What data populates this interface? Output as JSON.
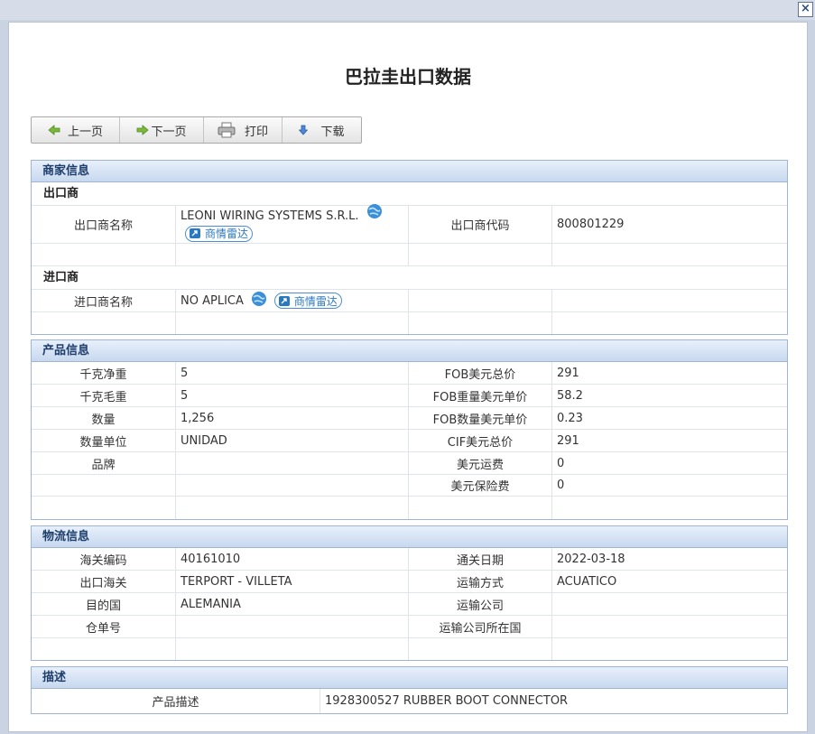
{
  "page_title": "巴拉圭出口数据",
  "toolbar": {
    "prev": "上一页",
    "next": "下一页",
    "print": "打印",
    "download": "下载"
  },
  "merchant": {
    "header": "商家信息",
    "exporter_heading": "出口商",
    "exporter_name_label": "出口商名称",
    "exporter_name": "LEONI WIRING SYSTEMS S.R.L.",
    "exporter_code_label": "出口商代码",
    "exporter_code": "800801229",
    "importer_heading": "进口商",
    "importer_name_label": "进口商名称",
    "importer_name": "NO APLICA",
    "radar_label": "商情雷达"
  },
  "product": {
    "header": "产品信息",
    "rows": [
      {
        "l1": "千克净重",
        "v1": "5",
        "l2": "FOB美元总价",
        "v2": "291"
      },
      {
        "l1": "千克毛重",
        "v1": "5",
        "l2": "FOB重量美元单价",
        "v2": "58.2"
      },
      {
        "l1": "数量",
        "v1": "1,256",
        "l2": "FOB数量美元单价",
        "v2": "0.23"
      },
      {
        "l1": "数量单位",
        "v1": "UNIDAD",
        "l2": "CIF美元总价",
        "v2": "291"
      },
      {
        "l1": "品牌",
        "v1": "",
        "l2": "美元运费",
        "v2": "0"
      },
      {
        "l1": "",
        "v1": "",
        "l2": "美元保险费",
        "v2": "0"
      }
    ]
  },
  "logistics": {
    "header": "物流信息",
    "rows": [
      {
        "l1": "海关编码",
        "v1": "40161010",
        "l2": "通关日期",
        "v2": "2022-03-18"
      },
      {
        "l1": "出口海关",
        "v1": "TERPORT - VILLETA",
        "l2": "运输方式",
        "v2": "ACUATICO"
      },
      {
        "l1": "目的国",
        "v1": "ALEMANIA",
        "l2": "运输公司",
        "v2": ""
      },
      {
        "l1": "仓单号",
        "v1": "",
        "l2": "运输公司所在国",
        "v2": ""
      }
    ]
  },
  "description": {
    "header": "描述",
    "label": "产品描述",
    "value": "1928300527 RUBBER BOOT CONNECTOR"
  },
  "icons": {
    "close": "close-icon",
    "prev": "arrow-left-icon",
    "next": "arrow-right-icon",
    "print": "printer-icon",
    "download": "arrow-down-icon",
    "globe": "globe-icon",
    "radar": "radar-icon"
  },
  "colors": {
    "section_header_text": "#1d3d6b",
    "section_border": "#9fb5d2",
    "radar_blue": "#2b78c2"
  }
}
